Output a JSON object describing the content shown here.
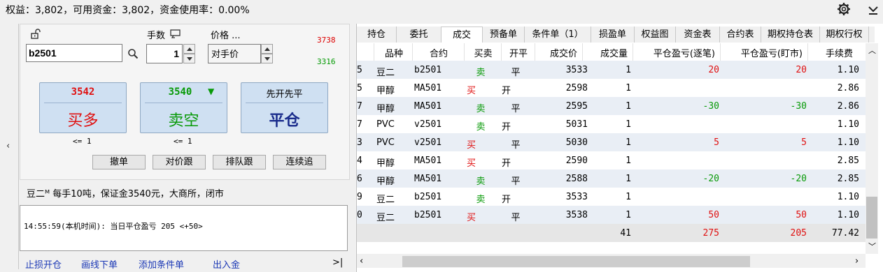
{
  "header": {
    "summary": "权益：3,802，可用资金：3,802，资金使用率：0.00%"
  },
  "order": {
    "symbol": "b2501",
    "qty_label": "手数",
    "qty": "1",
    "price_label": "价格 ...",
    "price_value": "对手价",
    "upper_limit": "3738",
    "lower_limit": "3316",
    "buy_price": "3542",
    "buy_label": "买多",
    "sell_price": "3540",
    "sell_label": "卖空",
    "close_top": "先开先平",
    "close_label": "平仓",
    "buy_note": "<= 1",
    "sell_note": "<= 1",
    "buttons": [
      "撤单",
      "对价跟",
      "排队跟",
      "连续追"
    ],
    "info": "豆二ᴹ 每手10吨，保证金3540元，大商所，闭市",
    "log": "14:55:59(本机时间): 当日平仓盈亏 205  <+50>"
  },
  "footer_links": [
    "止损开仓",
    "画线下单",
    "添加条件单",
    "出入金"
  ],
  "tabs": [
    "持仓",
    "委托",
    "成交",
    "预备单",
    "条件单（1）",
    "损盈单",
    "权益图",
    "资金表",
    "合约表",
    "期权持仓表",
    "期权行权"
  ],
  "active_tab": 2,
  "columns": [
    "品种",
    "合约",
    "买卖",
    "开平",
    "成交价",
    "成交量",
    "平仓盈亏(逐笔)",
    "平仓盈亏(盯市)",
    "手续费"
  ],
  "rows": [
    {
      "idx": "5",
      "variety": "豆二",
      "contract": "b2501",
      "side": "卖",
      "oc": "平",
      "price": "3533",
      "vol": "1",
      "pnl1": "20",
      "pnl2": "20",
      "fee": "1.10"
    },
    {
      "idx": "5",
      "variety": "甲醇",
      "contract": "MA501",
      "side": "买",
      "oc": "开",
      "price": "2598",
      "vol": "1",
      "pnl1": "",
      "pnl2": "",
      "fee": "2.86"
    },
    {
      "idx": "7",
      "variety": "甲醇",
      "contract": "MA501",
      "side": "卖",
      "oc": "平",
      "price": "2595",
      "vol": "1",
      "pnl1": "-30",
      "pnl2": "-30",
      "fee": "2.86"
    },
    {
      "idx": "7",
      "variety": "PVC",
      "contract": "v2501",
      "side": "卖",
      "oc": "开",
      "price": "5031",
      "vol": "1",
      "pnl1": "",
      "pnl2": "",
      "fee": "1.10"
    },
    {
      "idx": "3",
      "variety": "PVC",
      "contract": "v2501",
      "side": "买",
      "oc": "平",
      "price": "5030",
      "vol": "1",
      "pnl1": "5",
      "pnl2": "5",
      "fee": "1.10"
    },
    {
      "idx": "4",
      "variety": "甲醇",
      "contract": "MA501",
      "side": "买",
      "oc": "开",
      "price": "2590",
      "vol": "1",
      "pnl1": "",
      "pnl2": "",
      "fee": "2.85"
    },
    {
      "idx": "6",
      "variety": "甲醇",
      "contract": "MA501",
      "side": "卖",
      "oc": "平",
      "price": "2588",
      "vol": "1",
      "pnl1": "-20",
      "pnl2": "-20",
      "fee": "2.85"
    },
    {
      "idx": "9",
      "variety": "豆二",
      "contract": "b2501",
      "side": "卖",
      "oc": "开",
      "price": "3533",
      "vol": "1",
      "pnl1": "",
      "pnl2": "",
      "fee": "1.10"
    },
    {
      "idx": "0",
      "variety": "豆二",
      "contract": "b2501",
      "side": "买",
      "oc": "平",
      "price": "3538",
      "vol": "1",
      "pnl1": "50",
      "pnl2": "50",
      "fee": "1.10"
    }
  ],
  "totals": {
    "vol": "41",
    "pnl1": "275",
    "pnl2": "205",
    "fee": "77.42"
  },
  "colors": {
    "buy": "#e01010",
    "sell": "#089a08",
    "accent_button": "#cfe0f2"
  }
}
